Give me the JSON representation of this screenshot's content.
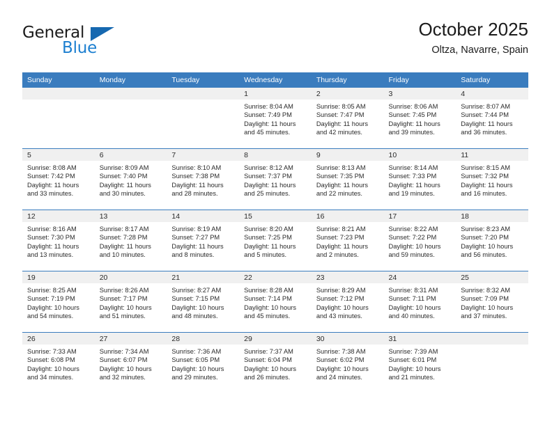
{
  "brand": {
    "name_part1": "General",
    "name_part2": "Blue",
    "triangle_icon": "triangle-icon",
    "accent_color": "#1c7fd0",
    "header_color": "#3a7cbe"
  },
  "header": {
    "title": "October 2025",
    "subtitle": "Oltza, Navarre, Spain"
  },
  "weekday_headers": [
    "Sunday",
    "Monday",
    "Tuesday",
    "Wednesday",
    "Thursday",
    "Friday",
    "Saturday"
  ],
  "weeks": [
    [
      {
        "day": "",
        "sunrise": "",
        "sunset": "",
        "daylight_line1": "",
        "daylight_line2": ""
      },
      {
        "day": "",
        "sunrise": "",
        "sunset": "",
        "daylight_line1": "",
        "daylight_line2": ""
      },
      {
        "day": "",
        "sunrise": "",
        "sunset": "",
        "daylight_line1": "",
        "daylight_line2": ""
      },
      {
        "day": "1",
        "sunrise": "Sunrise: 8:04 AM",
        "sunset": "Sunset: 7:49 PM",
        "daylight_line1": "Daylight: 11 hours",
        "daylight_line2": "and 45 minutes."
      },
      {
        "day": "2",
        "sunrise": "Sunrise: 8:05 AM",
        "sunset": "Sunset: 7:47 PM",
        "daylight_line1": "Daylight: 11 hours",
        "daylight_line2": "and 42 minutes."
      },
      {
        "day": "3",
        "sunrise": "Sunrise: 8:06 AM",
        "sunset": "Sunset: 7:45 PM",
        "daylight_line1": "Daylight: 11 hours",
        "daylight_line2": "and 39 minutes."
      },
      {
        "day": "4",
        "sunrise": "Sunrise: 8:07 AM",
        "sunset": "Sunset: 7:44 PM",
        "daylight_line1": "Daylight: 11 hours",
        "daylight_line2": "and 36 minutes."
      }
    ],
    [
      {
        "day": "5",
        "sunrise": "Sunrise: 8:08 AM",
        "sunset": "Sunset: 7:42 PM",
        "daylight_line1": "Daylight: 11 hours",
        "daylight_line2": "and 33 minutes."
      },
      {
        "day": "6",
        "sunrise": "Sunrise: 8:09 AM",
        "sunset": "Sunset: 7:40 PM",
        "daylight_line1": "Daylight: 11 hours",
        "daylight_line2": "and 30 minutes."
      },
      {
        "day": "7",
        "sunrise": "Sunrise: 8:10 AM",
        "sunset": "Sunset: 7:38 PM",
        "daylight_line1": "Daylight: 11 hours",
        "daylight_line2": "and 28 minutes."
      },
      {
        "day": "8",
        "sunrise": "Sunrise: 8:12 AM",
        "sunset": "Sunset: 7:37 PM",
        "daylight_line1": "Daylight: 11 hours",
        "daylight_line2": "and 25 minutes."
      },
      {
        "day": "9",
        "sunrise": "Sunrise: 8:13 AM",
        "sunset": "Sunset: 7:35 PM",
        "daylight_line1": "Daylight: 11 hours",
        "daylight_line2": "and 22 minutes."
      },
      {
        "day": "10",
        "sunrise": "Sunrise: 8:14 AM",
        "sunset": "Sunset: 7:33 PM",
        "daylight_line1": "Daylight: 11 hours",
        "daylight_line2": "and 19 minutes."
      },
      {
        "day": "11",
        "sunrise": "Sunrise: 8:15 AM",
        "sunset": "Sunset: 7:32 PM",
        "daylight_line1": "Daylight: 11 hours",
        "daylight_line2": "and 16 minutes."
      }
    ],
    [
      {
        "day": "12",
        "sunrise": "Sunrise: 8:16 AM",
        "sunset": "Sunset: 7:30 PM",
        "daylight_line1": "Daylight: 11 hours",
        "daylight_line2": "and 13 minutes."
      },
      {
        "day": "13",
        "sunrise": "Sunrise: 8:17 AM",
        "sunset": "Sunset: 7:28 PM",
        "daylight_line1": "Daylight: 11 hours",
        "daylight_line2": "and 10 minutes."
      },
      {
        "day": "14",
        "sunrise": "Sunrise: 8:19 AM",
        "sunset": "Sunset: 7:27 PM",
        "daylight_line1": "Daylight: 11 hours",
        "daylight_line2": "and 8 minutes."
      },
      {
        "day": "15",
        "sunrise": "Sunrise: 8:20 AM",
        "sunset": "Sunset: 7:25 PM",
        "daylight_line1": "Daylight: 11 hours",
        "daylight_line2": "and 5 minutes."
      },
      {
        "day": "16",
        "sunrise": "Sunrise: 8:21 AM",
        "sunset": "Sunset: 7:23 PM",
        "daylight_line1": "Daylight: 11 hours",
        "daylight_line2": "and 2 minutes."
      },
      {
        "day": "17",
        "sunrise": "Sunrise: 8:22 AM",
        "sunset": "Sunset: 7:22 PM",
        "daylight_line1": "Daylight: 10 hours",
        "daylight_line2": "and 59 minutes."
      },
      {
        "day": "18",
        "sunrise": "Sunrise: 8:23 AM",
        "sunset": "Sunset: 7:20 PM",
        "daylight_line1": "Daylight: 10 hours",
        "daylight_line2": "and 56 minutes."
      }
    ],
    [
      {
        "day": "19",
        "sunrise": "Sunrise: 8:25 AM",
        "sunset": "Sunset: 7:19 PM",
        "daylight_line1": "Daylight: 10 hours",
        "daylight_line2": "and 54 minutes."
      },
      {
        "day": "20",
        "sunrise": "Sunrise: 8:26 AM",
        "sunset": "Sunset: 7:17 PM",
        "daylight_line1": "Daylight: 10 hours",
        "daylight_line2": "and 51 minutes."
      },
      {
        "day": "21",
        "sunrise": "Sunrise: 8:27 AM",
        "sunset": "Sunset: 7:15 PM",
        "daylight_line1": "Daylight: 10 hours",
        "daylight_line2": "and 48 minutes."
      },
      {
        "day": "22",
        "sunrise": "Sunrise: 8:28 AM",
        "sunset": "Sunset: 7:14 PM",
        "daylight_line1": "Daylight: 10 hours",
        "daylight_line2": "and 45 minutes."
      },
      {
        "day": "23",
        "sunrise": "Sunrise: 8:29 AM",
        "sunset": "Sunset: 7:12 PM",
        "daylight_line1": "Daylight: 10 hours",
        "daylight_line2": "and 43 minutes."
      },
      {
        "day": "24",
        "sunrise": "Sunrise: 8:31 AM",
        "sunset": "Sunset: 7:11 PM",
        "daylight_line1": "Daylight: 10 hours",
        "daylight_line2": "and 40 minutes."
      },
      {
        "day": "25",
        "sunrise": "Sunrise: 8:32 AM",
        "sunset": "Sunset: 7:09 PM",
        "daylight_line1": "Daylight: 10 hours",
        "daylight_line2": "and 37 minutes."
      }
    ],
    [
      {
        "day": "26",
        "sunrise": "Sunrise: 7:33 AM",
        "sunset": "Sunset: 6:08 PM",
        "daylight_line1": "Daylight: 10 hours",
        "daylight_line2": "and 34 minutes."
      },
      {
        "day": "27",
        "sunrise": "Sunrise: 7:34 AM",
        "sunset": "Sunset: 6:07 PM",
        "daylight_line1": "Daylight: 10 hours",
        "daylight_line2": "and 32 minutes."
      },
      {
        "day": "28",
        "sunrise": "Sunrise: 7:36 AM",
        "sunset": "Sunset: 6:05 PM",
        "daylight_line1": "Daylight: 10 hours",
        "daylight_line2": "and 29 minutes."
      },
      {
        "day": "29",
        "sunrise": "Sunrise: 7:37 AM",
        "sunset": "Sunset: 6:04 PM",
        "daylight_line1": "Daylight: 10 hours",
        "daylight_line2": "and 26 minutes."
      },
      {
        "day": "30",
        "sunrise": "Sunrise: 7:38 AM",
        "sunset": "Sunset: 6:02 PM",
        "daylight_line1": "Daylight: 10 hours",
        "daylight_line2": "and 24 minutes."
      },
      {
        "day": "31",
        "sunrise": "Sunrise: 7:39 AM",
        "sunset": "Sunset: 6:01 PM",
        "daylight_line1": "Daylight: 10 hours",
        "daylight_line2": "and 21 minutes."
      },
      {
        "day": "",
        "sunrise": "",
        "sunset": "",
        "daylight_line1": "",
        "daylight_line2": ""
      }
    ]
  ]
}
